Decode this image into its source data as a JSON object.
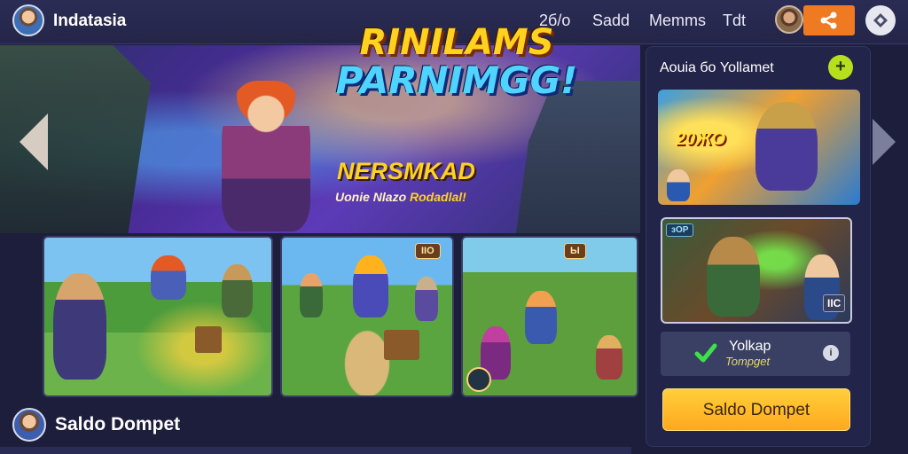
{
  "header": {
    "brand": "Indatasia",
    "nav": [
      "2б/о",
      "Sadd",
      "Memms",
      "Tdt"
    ]
  },
  "hero": {
    "title_line1": "RINILAMS",
    "title_line2": "PARNIMGG!",
    "subtitle": "NERSMKAD",
    "caption_prefix": "Uonie Nlazo ",
    "caption_highlight": "Rodadlal!"
  },
  "cards": [
    {
      "badge": ""
    },
    {
      "badge": "IIO"
    },
    {
      "badge": "Ы"
    }
  ],
  "panel": {
    "title": "Aouia бо Yollamet",
    "plus": "+",
    "promo_text": "20ЖО",
    "card2_badge": "зOP",
    "card2_tag": "IIC",
    "status_title": "Yolkap",
    "status_subtitle": "Tompget",
    "status_info": "i",
    "cta_label": "Saldo Dompet"
  },
  "footer": {
    "saldo_label": "Saldo Dompet"
  },
  "colors": {
    "accent_orange": "#f07a22",
    "cta_yellow": "#ffb82a",
    "bg_dark": "#1d1e3c",
    "plus_green": "#b6e01e"
  }
}
